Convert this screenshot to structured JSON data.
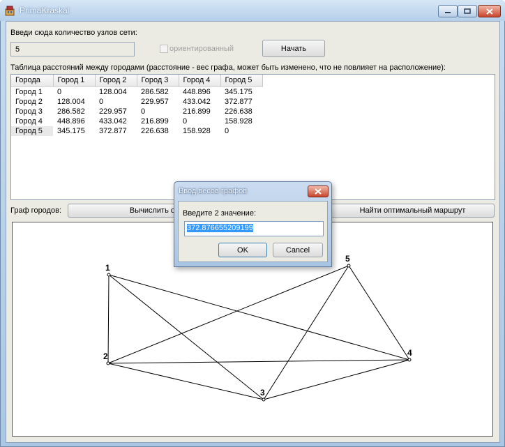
{
  "window": {
    "title": "PrimaKraskal",
    "accent_color": "#b5cfe9",
    "close_color": "#c8452c"
  },
  "form": {
    "nodes_label": "Введи сюда количество узлов сети:",
    "nodes_value": "5",
    "directed_label": "ориентированный",
    "directed_checked": false,
    "start_button": "Начать",
    "table_caption": "Таблица расстояний между городами (расстояние - вес графа, может быть изменено, что не повлияет на расположение):",
    "graph_label": "Граф городов:",
    "calc_button": "Вычислить опти",
    "find_button": "Найти оптимальный маршрут"
  },
  "table": {
    "columns": [
      "Города",
      "Город 1",
      "Город 2",
      "Город 3",
      "Город 4",
      "Город 5"
    ],
    "rows": [
      [
        "Город 1",
        "0",
        "128.004",
        "286.582",
        "448.896",
        "345.175"
      ],
      [
        "Город 2",
        "128.004",
        "0",
        "229.957",
        "433.042",
        "372.877"
      ],
      [
        "Город 3",
        "286.582",
        "229.957",
        "0",
        "216.899",
        "226.638"
      ],
      [
        "Город 4",
        "448.896",
        "433.042",
        "216.899",
        "0",
        "158.928"
      ],
      [
        "Город 5",
        "345.175",
        "372.877",
        "226.638",
        "158.928",
        "0"
      ]
    ]
  },
  "graph": {
    "node_labels": [
      "1",
      "2",
      "3",
      "4",
      "5"
    ],
    "edges": [
      [
        1,
        2
      ],
      [
        1,
        3
      ],
      [
        1,
        4
      ],
      [
        2,
        3
      ],
      [
        2,
        4
      ],
      [
        2,
        5
      ],
      [
        3,
        4
      ],
      [
        3,
        5
      ],
      [
        4,
        5
      ]
    ]
  },
  "dialog": {
    "title": "Ввод весов графов",
    "prompt": "Введите 2 значение:",
    "value": "372.876655209199",
    "ok_button": "OK",
    "cancel_button": "Cancel"
  }
}
